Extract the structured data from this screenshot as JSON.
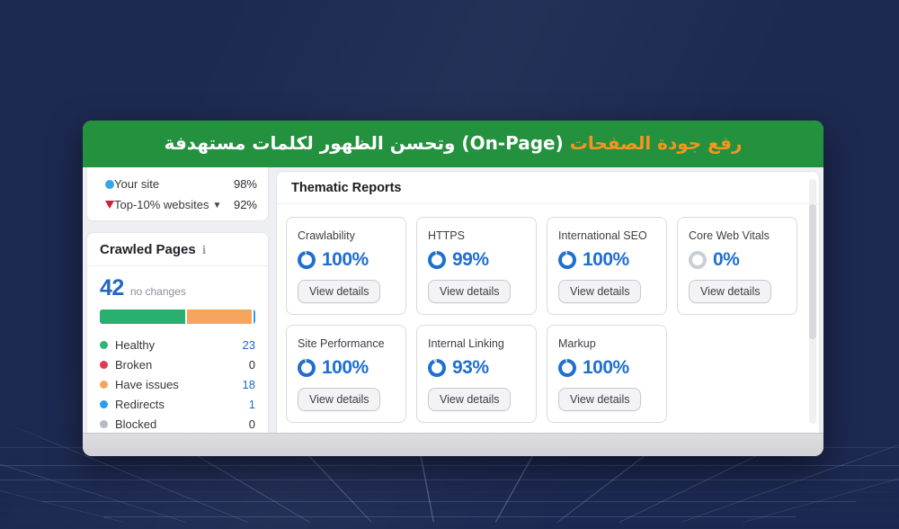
{
  "banner": {
    "highlight": "رفع جودة الصفحات",
    "rest": " (On-Page) وتحسن الظهور لكلمات مستهدفة",
    "bg_color": "#23913E",
    "highlight_color": "#F7941D"
  },
  "legend": {
    "your_site": {
      "label": "Your site",
      "value": "98%"
    },
    "top10": {
      "label": "Top-10% websites",
      "value": "92%"
    }
  },
  "crawled": {
    "title": "Crawled Pages",
    "info_icon": "i",
    "count": "42",
    "count_note": "no changes",
    "bar": [
      {
        "name": "healthy",
        "color": "#29AF70",
        "pct": 54.8
      },
      {
        "name": "have-issues",
        "color": "#F6A55F",
        "pct": 42.8
      },
      {
        "name": "redirects",
        "color": "#2E9BEF",
        "pct": 2.4
      }
    ],
    "rows": [
      {
        "label": "Healthy",
        "value": "23",
        "color": "#2BB673",
        "link": true
      },
      {
        "label": "Broken",
        "value": "0",
        "color": "#E23950",
        "link": false
      },
      {
        "label": "Have issues",
        "value": "18",
        "color": "#F6A55F",
        "link": true
      },
      {
        "label": "Redirects",
        "value": "1",
        "color": "#2E9BEF",
        "link": true
      },
      {
        "label": "Blocked",
        "value": "0",
        "color": "#B7BAC2",
        "link": false
      }
    ]
  },
  "thematic": {
    "title": "Thematic Reports",
    "view_details": "View details",
    "accent": "#1F6FD1",
    "ring_gray": "#C9CED6",
    "cards": [
      {
        "title": "Crawlability",
        "score": 100,
        "score_label": "100%"
      },
      {
        "title": "HTTPS",
        "score": 99,
        "score_label": "99%"
      },
      {
        "title": "International SEO",
        "score": 100,
        "score_label": "100%"
      },
      {
        "title": "Core Web Vitals",
        "score": 0,
        "score_label": "0%"
      },
      {
        "title": "Site Performance",
        "score": 100,
        "score_label": "100%"
      },
      {
        "title": "Internal Linking",
        "score": 93,
        "score_label": "93%"
      },
      {
        "title": "Markup",
        "score": 100,
        "score_label": "100%"
      }
    ]
  },
  "chart_data": {
    "type": "bar",
    "title": "Crawled Pages breakdown",
    "categories": [
      "Healthy",
      "Broken",
      "Have issues",
      "Redirects",
      "Blocked"
    ],
    "values": [
      23,
      0,
      18,
      1,
      0
    ],
    "total": 42
  }
}
